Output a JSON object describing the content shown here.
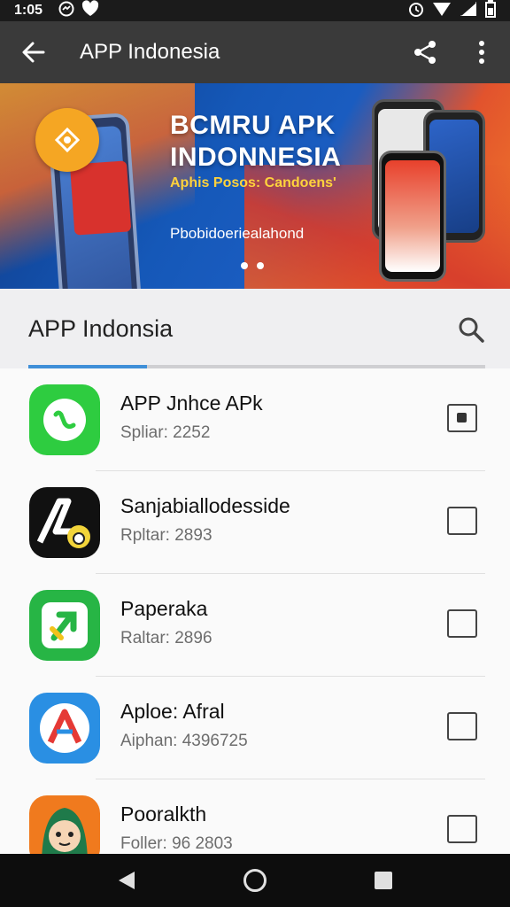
{
  "status_bar": {
    "time": "1:05",
    "left_icons": [
      "messenger-icon",
      "notification-icon"
    ],
    "right_icons": [
      "alarm-icon",
      "wifi-icon",
      "signal-icon",
      "battery-icon"
    ]
  },
  "app_bar": {
    "title": "APP Indonesia",
    "back_icon": "arrow-left-icon",
    "share_icon": "share-icon",
    "menu_icon": "more-vert-icon"
  },
  "banner": {
    "headline_line1": "BCMRU APK",
    "headline_line2": "INDONNESIA",
    "tagline": "Aphis Posos: Candoens'",
    "subline": "Pbobidoeriealahond",
    "page_indicator_count": 2
  },
  "section": {
    "title": "APP Indonsia",
    "search_icon": "search-icon",
    "scroll_progress": 0.26
  },
  "apps": [
    {
      "name": "APP Jnhce APk",
      "meta": "Spliar: 2252",
      "checked": true,
      "icon": "phone-app-icon",
      "colors": {
        "bg": "#2ecc40"
      }
    },
    {
      "name": "Sanjabiallodesside",
      "meta": "Rpltar: 2893",
      "checked": false,
      "icon": "dark-a-app-icon",
      "colors": {
        "bg": "#111111"
      }
    },
    {
      "name": "Paperaka",
      "meta": "Raltar: 2896",
      "checked": false,
      "icon": "green-arrow-app-icon",
      "colors": {
        "bg": "#27b545"
      }
    },
    {
      "name": "Aploe: Afral",
      "meta": "Aiphan: 4396725",
      "checked": false,
      "icon": "blue-a-app-icon",
      "colors": {
        "bg": "#2a8fe3"
      }
    },
    {
      "name": "Pooralkth",
      "meta": "Foller: 96 2803",
      "checked": false,
      "icon": "character-app-icon",
      "colors": {
        "bg": "#f07a1e"
      }
    }
  ],
  "nav_bar": {
    "back_icon": "nav-back-icon",
    "home_icon": "nav-home-icon",
    "recents_icon": "nav-recents-icon"
  },
  "colors": {
    "app_bar": "#3a3a3a",
    "accent": "#3f8fd8",
    "banner_blue": "#1558b8",
    "banner_orange": "#f07a2a"
  }
}
